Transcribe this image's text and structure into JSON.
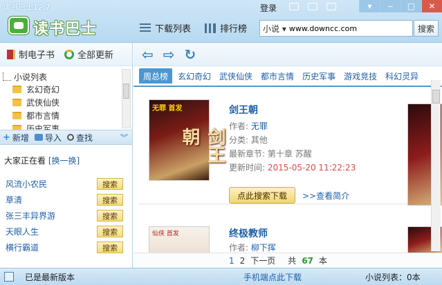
{
  "app": {
    "title": "读书巴士12.7",
    "logo_text": "读书巴士"
  },
  "header": {
    "login": "登录",
    "nav": [
      {
        "label": "下载列表",
        "icon": "list-icon"
      },
      {
        "label": "排行榜",
        "icon": "bar-chart-icon"
      }
    ],
    "search": {
      "type": "小说",
      "value": "www.downcc.com",
      "button": "搜索"
    },
    "window": {
      "minimize": "‒",
      "maximize": "□",
      "close": "✕",
      "menu": "▾"
    }
  },
  "left": {
    "tools": [
      {
        "label": "制电子书",
        "icon": "book-icon"
      },
      {
        "label": "全部更新",
        "icon": "refresh-icon"
      }
    ],
    "tree": {
      "root": "小说列表",
      "items": [
        "玄幻奇幻",
        "武侠仙侠",
        "都市言情",
        "历史军事"
      ]
    },
    "actions": {
      "add": "新增",
      "import": "导入",
      "find": "查找"
    },
    "watching": {
      "label": "大家正在看",
      "change": "[换一换]"
    },
    "popular": [
      {
        "name": "风流小农民",
        "button": "搜索"
      },
      {
        "name": "草清",
        "button": "搜索"
      },
      {
        "name": "张三丰异界游",
        "button": "搜索"
      },
      {
        "name": "天眼人生",
        "button": "搜索"
      },
      {
        "name": "横行霸道",
        "button": "搜索"
      }
    ]
  },
  "main": {
    "categories": [
      "周总榜",
      "玄幻奇幻",
      "武侠仙侠",
      "都市言情",
      "历史军事",
      "游戏竞技",
      "科幻灵异"
    ],
    "active_category": "周总榜",
    "books": [
      {
        "title": "剑王朝",
        "author_label": "作者:",
        "author": "无罪",
        "category_label": "分类:",
        "category": "其他",
        "chapter_label": "最新章节:",
        "chapter": "第十章 苏醒",
        "time_label": "更新时间:",
        "time": "2015-05-20 11:22:23",
        "cover_text": "剑王朝",
        "cover_tag": "无罪 首发",
        "download_button": "点此搜索下载",
        "intro_link": ">>查看简介"
      },
      {
        "title": "终极教师",
        "author_label": "作者:",
        "author": "柳下挥",
        "cover_tag": "仙侠 首发"
      }
    ],
    "pager": {
      "page1": "1",
      "page2": "2",
      "next": "下一页",
      "total_prefix": "共",
      "total": "67",
      "total_suffix": "本"
    }
  },
  "status": {
    "version": "已是最新版本",
    "mobile": "手机端点此下载",
    "count": "小说列表：0本"
  },
  "colors": {
    "accent": "#4b97d3",
    "link": "#1f5fa8",
    "highlight": "#e04848",
    "button": "#f1d573"
  }
}
